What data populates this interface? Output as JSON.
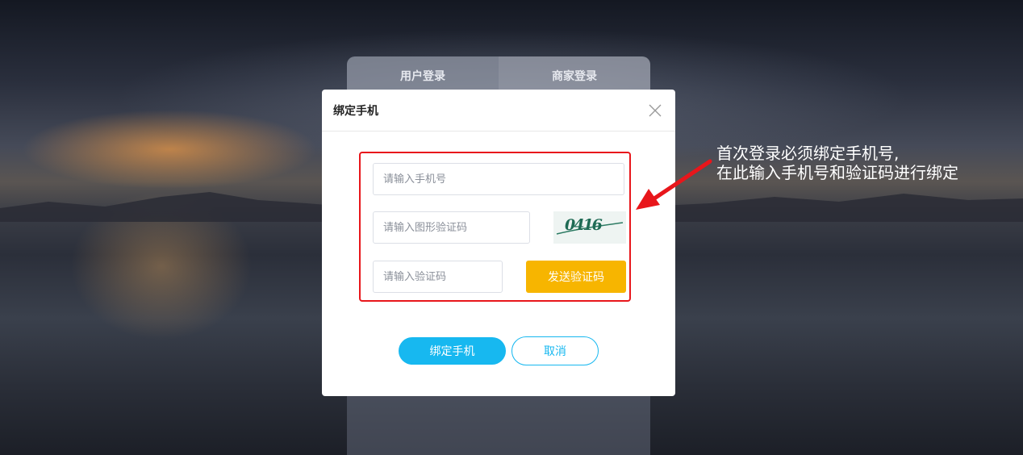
{
  "login_tabs": [
    {
      "label": "用户登录"
    },
    {
      "label": "商家登录"
    }
  ],
  "modal": {
    "title": "绑定手机",
    "phone_placeholder": "请输入手机号",
    "image_code_placeholder": "请输入图形验证码",
    "captcha_text": "0416",
    "sms_code_placeholder": "请输入验证码",
    "send_code_label": "发送验证码",
    "bind_label": "绑定手机",
    "cancel_label": "取消"
  },
  "annotation": {
    "line1": "首次登录必须绑定手机号,",
    "line2": "在此输入手机号和验证码进行绑定"
  },
  "colors": {
    "primary": "#17b8f0",
    "warning": "#f7b500",
    "highlight_border": "#e8161b"
  }
}
